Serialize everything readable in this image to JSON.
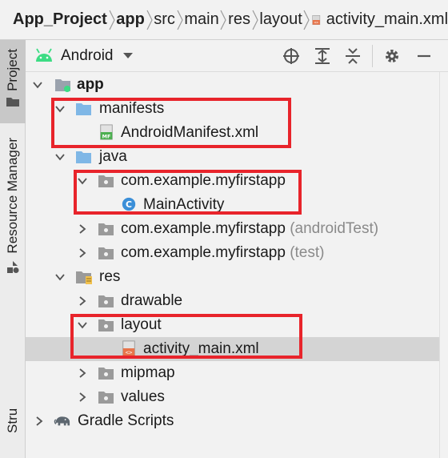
{
  "breadcrumb": {
    "items": [
      "App_Project",
      "app",
      "src",
      "main",
      "res",
      "layout",
      "activity_main.xml"
    ],
    "file_icon": "layout-xml-icon"
  },
  "sidebar": {
    "project_tab": "Project",
    "resource_manager_tab": "Resource Manager",
    "structure_tab": "Structure"
  },
  "toolbar": {
    "view_mode": "Android",
    "buttons": [
      "crosshair-icon",
      "expand-all-icon",
      "collapse-all-icon",
      "gear-icon",
      "minimize-icon"
    ]
  },
  "tree": {
    "app": "app",
    "manifests": "manifests",
    "android_manifest": "AndroidManifest.xml",
    "java": "java",
    "pkg_main": "com.example.myfirstapp",
    "main_activity": "MainActivity",
    "pkg_android_test": "com.example.myfirstapp",
    "pkg_android_test_hint": "(androidTest)",
    "pkg_test": "com.example.myfirstapp",
    "pkg_test_hint": "(test)",
    "res": "res",
    "drawable": "drawable",
    "layout": "layout",
    "activity_main": "activity_main.xml",
    "mipmap": "mipmap",
    "values": "values",
    "gradle_scripts": "Gradle Scripts"
  },
  "colors": {
    "highlight": "#e8242b",
    "android_green": "#3ddc84",
    "folder_blue": "#7fb7e6",
    "class_blue": "#3b8fd8"
  }
}
